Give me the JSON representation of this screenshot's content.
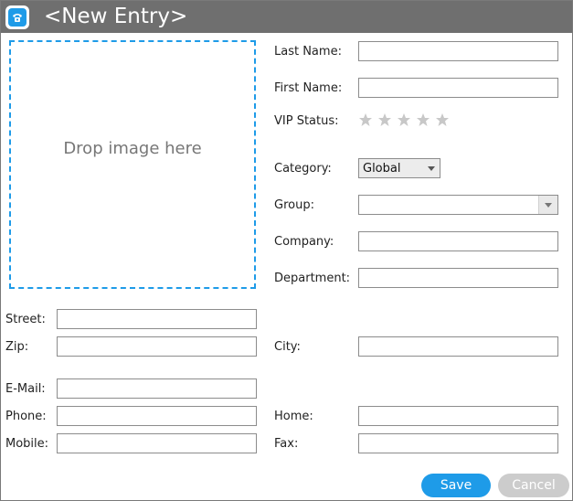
{
  "window": {
    "title": "<New Entry>",
    "icon": "phone-icon",
    "accent_color": "#1e9be8",
    "titlebar_color": "#6f6f6f"
  },
  "image_drop": {
    "label": "Drop image here"
  },
  "fields": {
    "last_name": {
      "label": "Last Name:",
      "value": ""
    },
    "first_name": {
      "label": "First Name:",
      "value": ""
    },
    "vip_status": {
      "label": "VIP Status:",
      "rating": 0,
      "max_rating": 5
    },
    "category": {
      "label": "Category:",
      "selected": "Global"
    },
    "group": {
      "label": "Group:",
      "selected": ""
    },
    "company": {
      "label": "Company:",
      "value": ""
    },
    "department": {
      "label": "Department:",
      "value": ""
    },
    "street": {
      "label": "Street:",
      "value": ""
    },
    "zip": {
      "label": "Zip:",
      "value": ""
    },
    "city": {
      "label": "City:",
      "value": ""
    },
    "email": {
      "label": "E-Mail:",
      "value": ""
    },
    "phone": {
      "label": "Phone:",
      "value": ""
    },
    "home": {
      "label": "Home:",
      "value": ""
    },
    "mobile": {
      "label": "Mobile:",
      "value": ""
    },
    "fax": {
      "label": "Fax:",
      "value": ""
    }
  },
  "buttons": {
    "save": "Save",
    "cancel": "Cancel"
  }
}
